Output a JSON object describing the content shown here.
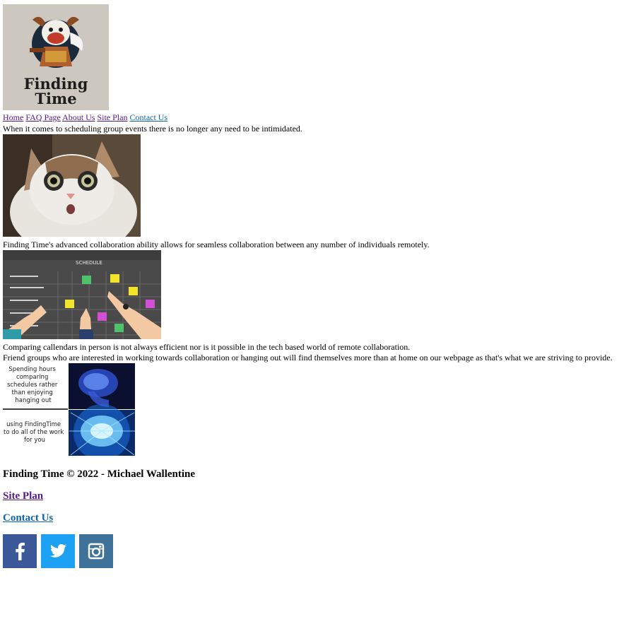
{
  "logo": {
    "line1": "Finding",
    "line2": "Time"
  },
  "nav": {
    "home": "Home",
    "faq": "FAQ Page",
    "about": "About Us",
    "site_plan": "Site Plan",
    "contact": "Contact Us"
  },
  "content": {
    "intro": "When it comes to scheduling group events there is no longer any need to be intimidated.",
    "collab": "Finding Time's advanced collaboration ability allows for seamless collaboration between any number of individuals remotely.",
    "compare": "Comparing callendars in person is not always efficient nor is it possible in the tech based world of remote collaboration.",
    "friends": "Friend groups who are interested in working towards collaboration or hanging out will find themselves more than at home on our webpage as that's what we are striving to provide."
  },
  "schedule_image": {
    "header": "SCHEDULE"
  },
  "meme": {
    "top_text": [
      "Spending hours",
      "comparing",
      "schedules rather",
      "than enjoying",
      "hanging out"
    ],
    "bottom_text": [
      "using FindingTime",
      "to do all of the work",
      "for you"
    ]
  },
  "footer": {
    "copyright": "Finding Time © 2022 - Michael Wallentine",
    "site_plan": "Site Plan",
    "contact": "Contact Us"
  },
  "social": {
    "facebook_color": "#3b5998",
    "twitter_color": "#1da1f2",
    "instagram_color": "#3f729b"
  }
}
